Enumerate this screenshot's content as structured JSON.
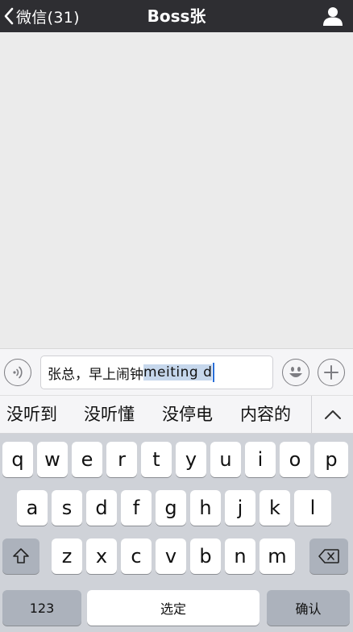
{
  "navbar": {
    "back_label": "微信(31)",
    "title": "Boss张",
    "profile_icon": "person-icon"
  },
  "input_bar": {
    "voice_icon": "voice-icon",
    "text_committed": "张总，早上闹钟",
    "text_composing": "meiting d",
    "emoji_icon": "emoji-icon",
    "plus_icon": "plus-icon"
  },
  "candidates": [
    "没听到",
    "没听懂",
    "没停电",
    "内容的"
  ],
  "candidate_expand_icon": "chevron-up-icon",
  "keyboard": {
    "row1": [
      "q",
      "w",
      "e",
      "r",
      "t",
      "y",
      "u",
      "i",
      "o",
      "p"
    ],
    "row2": [
      "a",
      "s",
      "d",
      "f",
      "g",
      "h",
      "j",
      "k",
      "l"
    ],
    "row3": [
      "z",
      "x",
      "c",
      "v",
      "b",
      "n",
      "m"
    ],
    "shift_icon": "shift-icon",
    "delete_icon": "backspace-icon",
    "numbers_label": "123",
    "space_label": "选定",
    "return_label": "确认"
  },
  "colors": {
    "navbar_bg": "#2e2e32",
    "chat_bg": "#ebebeb",
    "keyboard_bg": "#cfd2d8",
    "marked_text_bg": "#c6d7ec"
  }
}
